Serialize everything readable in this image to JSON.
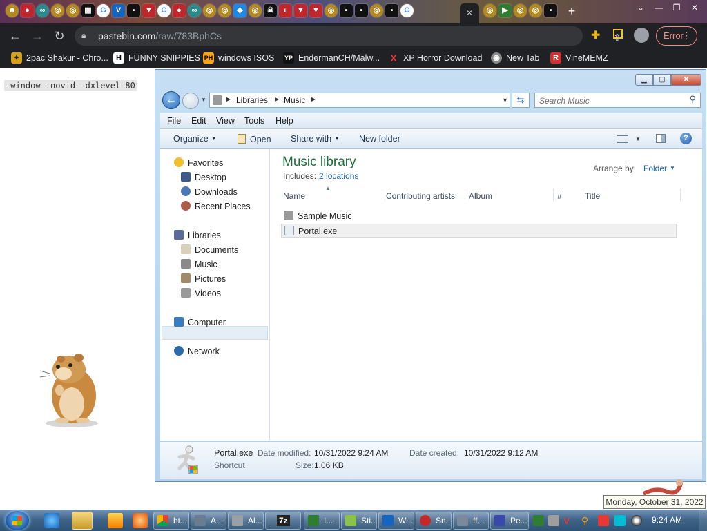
{
  "browser": {
    "url_host": "pastebin.com",
    "url_path": "/raw/783BphCs",
    "error_label": "Error",
    "new_tab_glyph": "+",
    "close_tab_glyph": "×",
    "bookmarks": [
      {
        "label": "2pac Shakur - Chro...",
        "icon": "puzzle-icon",
        "color": "#d4a017"
      },
      {
        "label": "FUNNY SNIPPIES",
        "icon": "H",
        "color": "#ffffff"
      },
      {
        "label": "windows ISOS",
        "icon": "PH",
        "color": "#ffa31a"
      },
      {
        "label": "EndermanCH/Malw...",
        "icon": "YP",
        "color": "#111111"
      },
      {
        "label": "XP Horror Download",
        "icon": "X",
        "color": "#e53935"
      },
      {
        "label": "New Tab",
        "icon": "globe-icon",
        "color": "#8a8a8a"
      },
      {
        "label": "VineMEMZ",
        "icon": "R",
        "color": "#d32f2f"
      }
    ]
  },
  "page": {
    "text": "-window -novid -dxlevel 80"
  },
  "explorer": {
    "breadcrumb": [
      "Libraries",
      "Music"
    ],
    "search_placeholder": "Search Music",
    "menu": [
      "File",
      "Edit",
      "View",
      "Tools",
      "Help"
    ],
    "commands": {
      "organize": "Organize",
      "open": "Open",
      "share_with": "Share with",
      "new_folder": "New folder"
    },
    "nav": {
      "favorites": "Favorites",
      "desktop": "Desktop",
      "downloads": "Downloads",
      "recent_places": "Recent Places",
      "libraries": "Libraries",
      "documents": "Documents",
      "music": "Music",
      "pictures": "Pictures",
      "videos": "Videos",
      "computer": "Computer",
      "network": "Network"
    },
    "content": {
      "title": "Music library",
      "includes_label": "Includes:",
      "includes_link": "2 locations",
      "arrange_label": "Arrange by:",
      "arrange_value": "Folder",
      "columns": [
        "Name",
        "Contributing artists",
        "Album",
        "#",
        "Title"
      ],
      "rows": [
        {
          "name": "Sample Music",
          "type": "folder"
        },
        {
          "name": "Portal.exe",
          "type": "shortcut",
          "selected": true
        }
      ]
    },
    "details": {
      "name": "Portal.exe",
      "type": "Shortcut",
      "modified_label": "Date modified:",
      "modified_value": "10/31/2022 9:24 AM",
      "created_label": "Date created:",
      "created_value": "10/31/2022 9:12 AM",
      "size_label": "Size:",
      "size_value": "1.06 KB"
    }
  },
  "taskbar": {
    "date_tooltip": "Monday, October 31, 2022",
    "clock": "9:24 AM",
    "buttons": [
      {
        "label": "ht...",
        "color": "#e0b040"
      },
      {
        "label": "A...",
        "color": "#6a7d90"
      },
      {
        "label": "Al...",
        "color": "#9aa0a6"
      },
      {
        "label": "7z",
        "color": "#222222"
      },
      {
        "label": "I...",
        "color": "#2e7d32"
      },
      {
        "label": "Sti...",
        "color": "#8bc34a"
      },
      {
        "label": "W...",
        "color": "#1565c0"
      },
      {
        "label": "Sn...",
        "color": "#c62828"
      },
      {
        "label": "ff...",
        "color": "#7a8a9a"
      },
      {
        "label": "Pe...",
        "color": "#3949ab"
      }
    ]
  }
}
